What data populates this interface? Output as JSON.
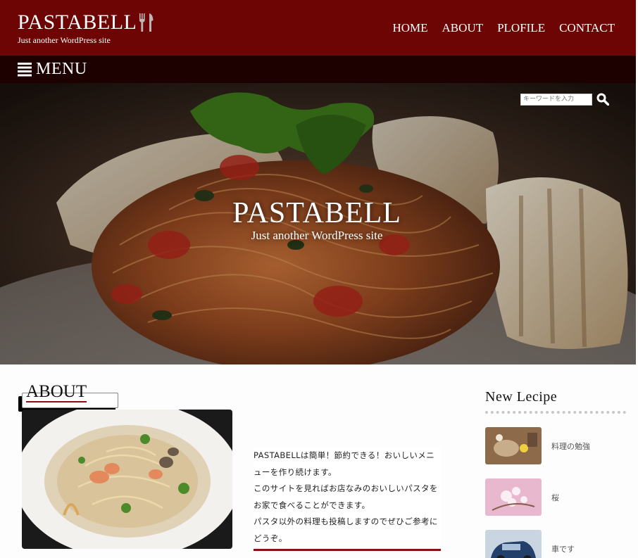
{
  "header": {
    "site_title": "PASTABELL",
    "tagline": "Just another WordPress site",
    "nav": [
      "HOME",
      "ABOUT",
      "PLOFILE",
      "CONTACT"
    ]
  },
  "menubar": {
    "label": "MENU"
  },
  "hero": {
    "search_placeholder": "キーワードを入力",
    "title": "PASTABELL",
    "subtitle": "Just another WordPress site"
  },
  "about": {
    "heading": "ABOUT",
    "paragraphs": [
      "PASTABELLは簡単！節約できる！おいしいメニューを作り続けます。",
      "このサイトを見ればお店なみのおいしいパスタをお家で食べることができます。",
      "パスタ以外の料理も投稿しますのでぜひご参考にどうぞ。"
    ]
  },
  "sidebar": {
    "title": "New Lecipe",
    "items": [
      {
        "label": "料理の勉強"
      },
      {
        "label": "桜"
      },
      {
        "label": "車です"
      }
    ]
  },
  "colors": {
    "brand": "#6e0505",
    "menubar": "#1d0000",
    "accent": "#8a1010"
  }
}
